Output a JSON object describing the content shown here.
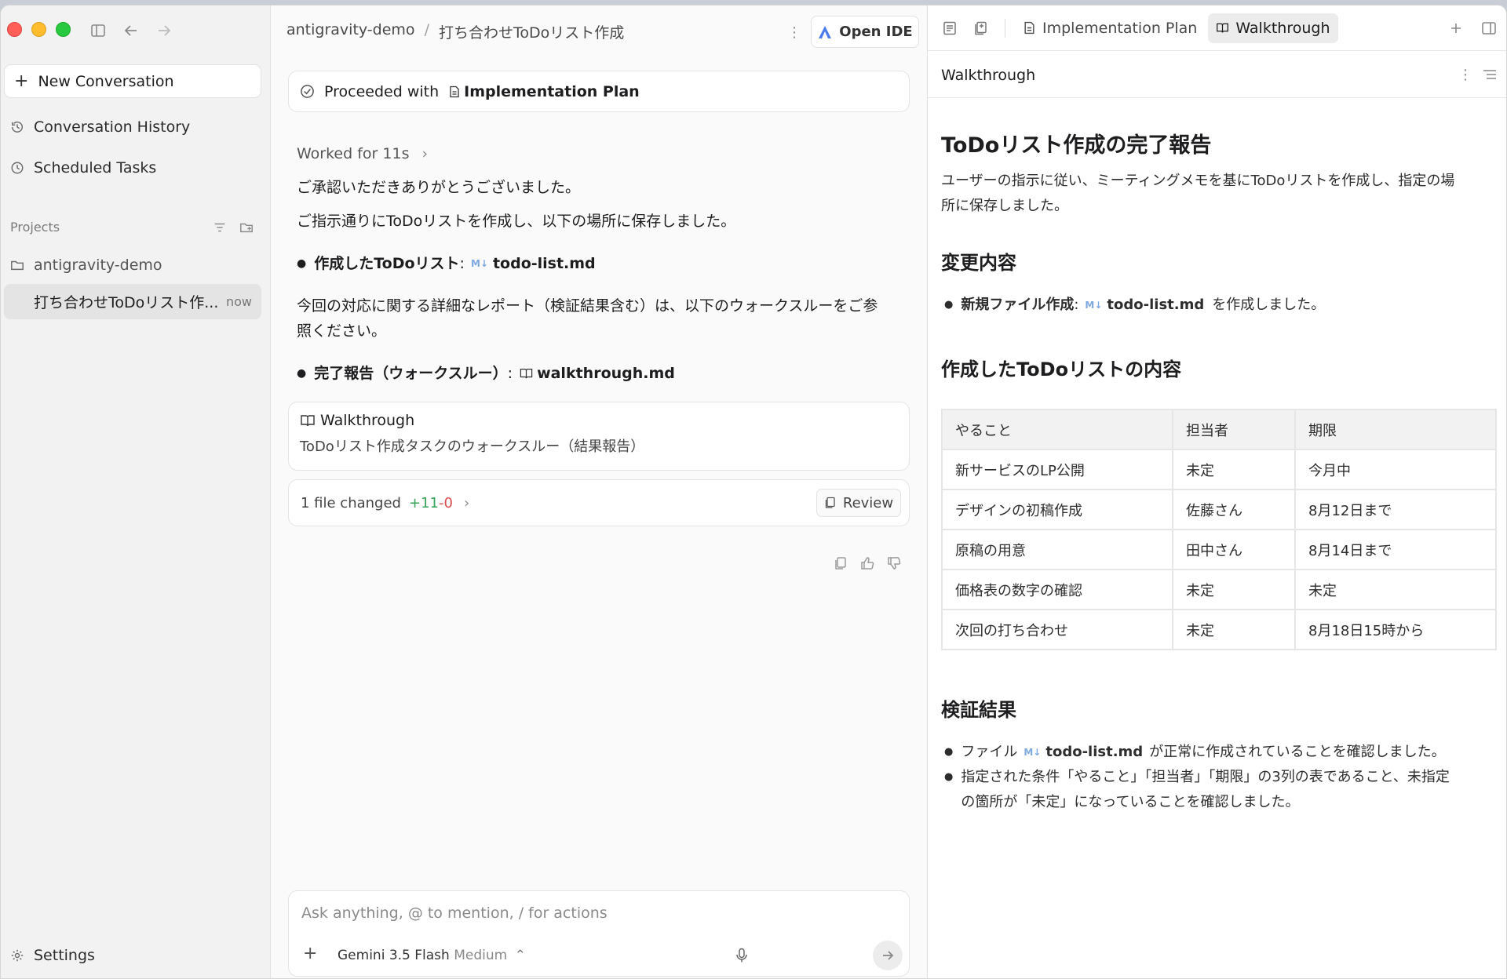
{
  "sidebar": {
    "new_conversation": "New Conversation",
    "history": "Conversation History",
    "scheduled": "Scheduled Tasks",
    "projects_label": "Projects",
    "project_name": "antigravity-demo",
    "active_conversation": "打ち合わせToDoリスト作...",
    "active_time": "now",
    "settings": "Settings"
  },
  "breadcrumb": {
    "project": "antigravity-demo",
    "sep": "/",
    "conversation": "打ち合わせToDoリスト作成"
  },
  "toolbar": {
    "open_ide": "Open IDE"
  },
  "chat": {
    "proceeded_prefix": "Proceeded with",
    "proceeded_doc": "Implementation Plan",
    "worked_for": "Worked for 11s",
    "line1": "ご承認いただきありがとうございました。",
    "line2": "ご指示通りにToDoリストを作成し、以下の場所に保存しました。",
    "bullet1_label": "作成したToDoリスト",
    "bullet1_colon": ":",
    "md_badge": "M↓",
    "bullet1_file": "todo-list.md",
    "para_line1": "今回の対応に関する詳細なレポート（検証結果含む）は、以下のウォークスルーをご参",
    "para_line2": "照ください。",
    "bullet2_label": "完了報告（ウォークスルー）",
    "bullet2_colon": ":",
    "bullet2_file": "walkthrough.md",
    "walk_title": "Walkthrough",
    "walk_desc": "ToDoリスト作成タスクのウォークスルー（結果報告）",
    "files_changed": "1 file changed",
    "added": "+11",
    "removed": "-0",
    "review": "Review"
  },
  "input": {
    "placeholder": "Ask anything, @ to mention, / for actions",
    "model": "Gemini 3.5 Flash",
    "model_level": "Medium"
  },
  "right": {
    "tabs": [
      {
        "label": "Implementation Plan",
        "active": false
      },
      {
        "label": "Walkthrough",
        "active": true
      }
    ],
    "header_title": "Walkthrough",
    "doc": {
      "h1": "ToDoリスト作成の完了報告",
      "intro_line1": "ユーザーの指示に従い、ミーティングメモを基にToDoリストを作成し、指定の場",
      "intro_line2": "所に保存しました。",
      "h2_changes": "変更内容",
      "change_label": "新規ファイル作成",
      "change_colon": ":",
      "change_file": "todo-list.md",
      "change_suffix": "を作成しました。",
      "h2_content": "作成したToDoリストの内容",
      "table": {
        "headers": [
          "やること",
          "担当者",
          "期限"
        ],
        "rows": [
          [
            "新サービスのLP公開",
            "未定",
            "今月中"
          ],
          [
            "デザインの初稿作成",
            "佐藤さん",
            "8月12日まで"
          ],
          [
            "原稿の用意",
            "田中さん",
            "8月14日まで"
          ],
          [
            "価格表の数字の確認",
            "未定",
            "未定"
          ],
          [
            "次回の打ち合わせ",
            "未定",
            "8月18日15時から"
          ]
        ]
      },
      "h2_verify": "検証結果",
      "verify1_prefix": "ファイル",
      "verify1_file": "todo-list.md",
      "verify1_suffix": "が正常に作成されていることを確認しました。",
      "verify2_line1": "指定された条件「やること」「担当者」「期限」の3列の表であること、未指定",
      "verify2_line2": "の箇所が「未定」になっていることを確認しました。"
    }
  },
  "colors": {
    "added": "#3aa35a",
    "removed": "#d94c4c",
    "md_badge": "#7ea8e0",
    "sidebar_bg": "#f2f2f2"
  }
}
